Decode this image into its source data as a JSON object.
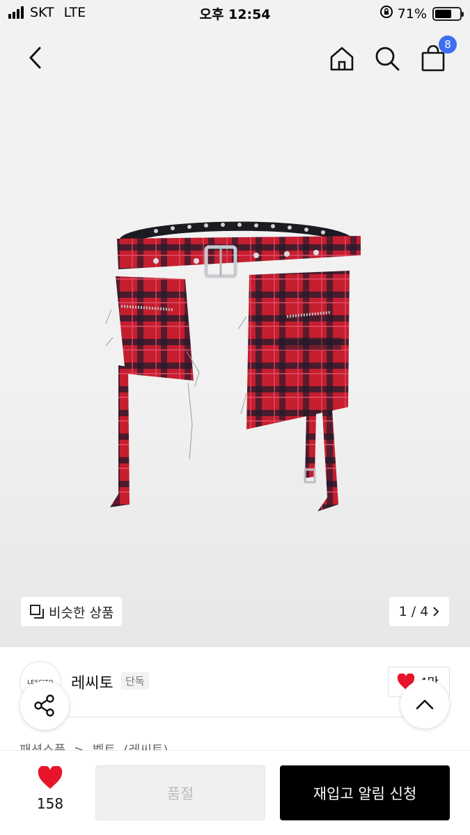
{
  "status_bar": {
    "carrier": "SKT",
    "network": "LTE",
    "time": "오후 12:54",
    "battery": "71%",
    "battery_level": 0.71
  },
  "nav": {
    "cart_count": "8",
    "icons": [
      "back-icon",
      "home-icon",
      "search-icon",
      "cart-icon"
    ]
  },
  "gallery": {
    "similar_label": "비슷한 상품",
    "current": "1",
    "separator": "/",
    "total": "4"
  },
  "product": {
    "brand_logo_text": "LESCITO",
    "brand": "레씨토",
    "exclusive_badge": "단독",
    "like_chip_text": "4만",
    "breadcrumb": [
      "패션소품",
      ">",
      "벨트",
      "(레씨토)"
    ]
  },
  "bottom_bar": {
    "likes": "158",
    "soldout_label": "품절",
    "restock_label": "재입고 알림 신청"
  },
  "colors": {
    "cart_badge": "#3d6ff0",
    "heart": "#e8142b",
    "plaid_red": "#c41e2f",
    "plaid_dark": "#1e1a2c"
  }
}
